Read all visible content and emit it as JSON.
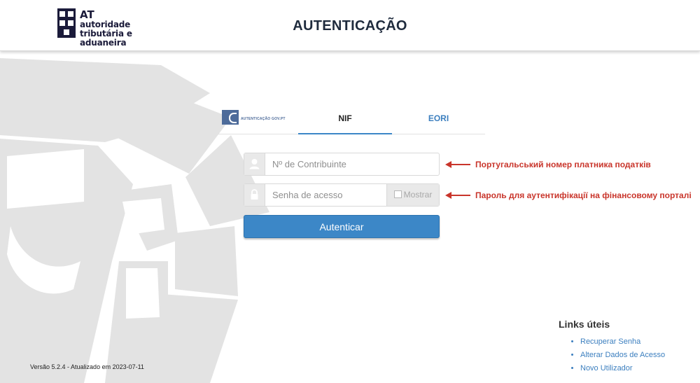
{
  "header": {
    "logo": {
      "acronym": "AT",
      "line1": "autoridade",
      "line2": "tributária e aduaneira"
    },
    "title": "AUTENTICAÇÃO"
  },
  "tabs": {
    "certificate_label": "AUTENTICAÇÃO GOV.PT",
    "nif": "NIF",
    "eori": "EORI"
  },
  "form": {
    "nif_placeholder": "Nº de Contribuinte",
    "password_placeholder": "Senha de acesso",
    "show_label": "Mostrar",
    "submit_label": "Autenticar",
    "user_icon": "user-icon",
    "lock_icon": "lock-icon"
  },
  "annotations": {
    "nif": "Португальський номер платника податків",
    "password": "Пароль для аутентифікації на фінансовому порталі",
    "color": "#c9352b"
  },
  "footer": {
    "version": "Versão 5.2.4 - Atualizado em 2023-07-11",
    "links_title": "Links úteis",
    "links": [
      "Recuperar Senha",
      "Alterar Dados de Acesso",
      "Novo Utilizador"
    ]
  },
  "colors": {
    "accent": "#3c87c7",
    "link": "#3c7fbf",
    "title": "#1f2b3d"
  }
}
